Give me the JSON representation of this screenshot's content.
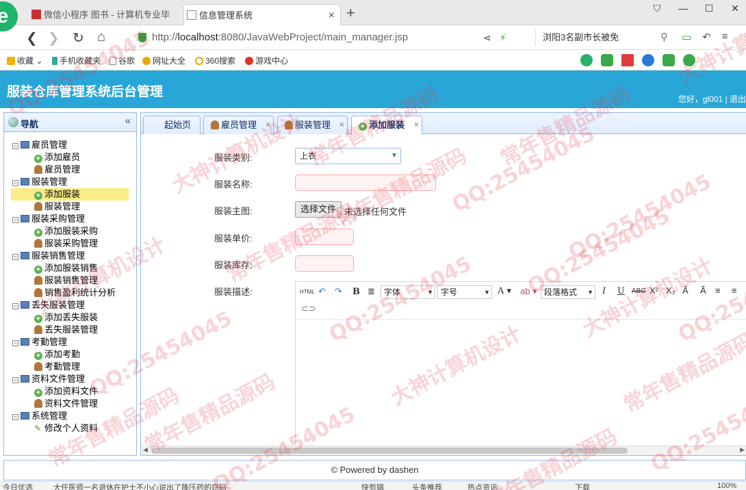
{
  "browser": {
    "tabs": [
      {
        "label": "微信小程序 图书 - 计算机专业毕"
      },
      {
        "label": "信息管理系统"
      }
    ],
    "new_tab_label": "+",
    "url_prefix": "http://",
    "url_host": "localhost",
    "url_rest": ":8080/JavaWebProject/main_manager.jsp",
    "search_text": "浏阳3名副市长被免",
    "logo_letter": "e",
    "bookmarks": [
      "收藏",
      "手机收藏夹",
      "谷歌",
      "网址大全",
      "360搜索",
      "游戏中心"
    ],
    "status_items": [
      "今日优选",
      "大任医师一名退休在护士不小心说出了降压药的窃码",
      "快剪辑",
      "头条推荐",
      "热点资讯",
      "下载",
      "100%"
    ]
  },
  "app": {
    "title": "服装仓库管理系统后台管理",
    "welcome": "您好，gl001 | 退出",
    "footer": "© Powered by dashen"
  },
  "sidebar": {
    "title": "导航",
    "collapse_icon": "«",
    "groups": [
      {
        "label": "雇员管理",
        "items": [
          {
            "label": "添加雇员",
            "icon": "plus"
          },
          {
            "label": "雇员管理",
            "icon": "person"
          }
        ]
      },
      {
        "label": "服装管理",
        "items": [
          {
            "label": "添加服装",
            "icon": "plus"
          },
          {
            "label": "服装管理",
            "icon": "person"
          }
        ]
      },
      {
        "label": "服装采购管理",
        "items": [
          {
            "label": "添加服装采购",
            "icon": "plus"
          },
          {
            "label": "服装采购管理",
            "icon": "person"
          }
        ]
      },
      {
        "label": "服装销售管理",
        "items": [
          {
            "label": "添加服装销售",
            "icon": "plus"
          },
          {
            "label": "服装销售管理",
            "icon": "person"
          },
          {
            "label": "销售盈利统计分析",
            "icon": "person"
          }
        ]
      },
      {
        "label": "丢失服装管理",
        "items": [
          {
            "label": "添加丢失服装",
            "icon": "plus"
          },
          {
            "label": "丢失服装管理",
            "icon": "person"
          }
        ]
      },
      {
        "label": "考勤管理",
        "items": [
          {
            "label": "添加考勤",
            "icon": "plus"
          },
          {
            "label": "考勤管理",
            "icon": "person"
          }
        ]
      },
      {
        "label": "资料文件管理",
        "items": [
          {
            "label": "添加资料文件",
            "icon": "plus"
          },
          {
            "label": "资料文件管理",
            "icon": "person"
          }
        ]
      },
      {
        "label": "系统管理",
        "items": [
          {
            "label": "修改个人资料",
            "icon": "pencil"
          }
        ]
      }
    ],
    "selected": "添加服装"
  },
  "main_tabs": [
    {
      "label": "起始页",
      "closable": false
    },
    {
      "label": "雇员管理",
      "closable": true
    },
    {
      "label": "服装管理",
      "closable": true
    },
    {
      "label": "添加服装",
      "closable": true,
      "active": true
    }
  ],
  "form": {
    "category_label": "服装类别:",
    "category_value": "上衣",
    "name_label": "服装名称:",
    "photo_label": "服装主图:",
    "file_button": "选择文件",
    "file_status": "未选择任何文件",
    "price_label": "服装单价:",
    "stock_label": "服装库存:",
    "desc_label": "服装描述:"
  },
  "editor": {
    "html_btn": "HTML",
    "font_label": "字体",
    "size_label": "字号",
    "para_label": "段落格式"
  },
  "watermarks": [
    "QQ:25454045",
    "大神计算机设计",
    "常年售精品源码",
    "QQ:25454045",
    "常年售精品源码",
    "大神计算机设计",
    "QQ:25454045",
    "常年售精品源码",
    "QQ:25454045",
    "大神计算机设计",
    "常年售精品源码",
    "QQ:25454045",
    "大神计算机设计",
    "常年售精品源码",
    "QQ:25454045",
    "常年售精品源码",
    "常年售精品源码",
    "QQ:25454045",
    "大神计算机设计",
    "QQ:25454045",
    "常年售精品源码",
    "QQ:25454045"
  ]
}
